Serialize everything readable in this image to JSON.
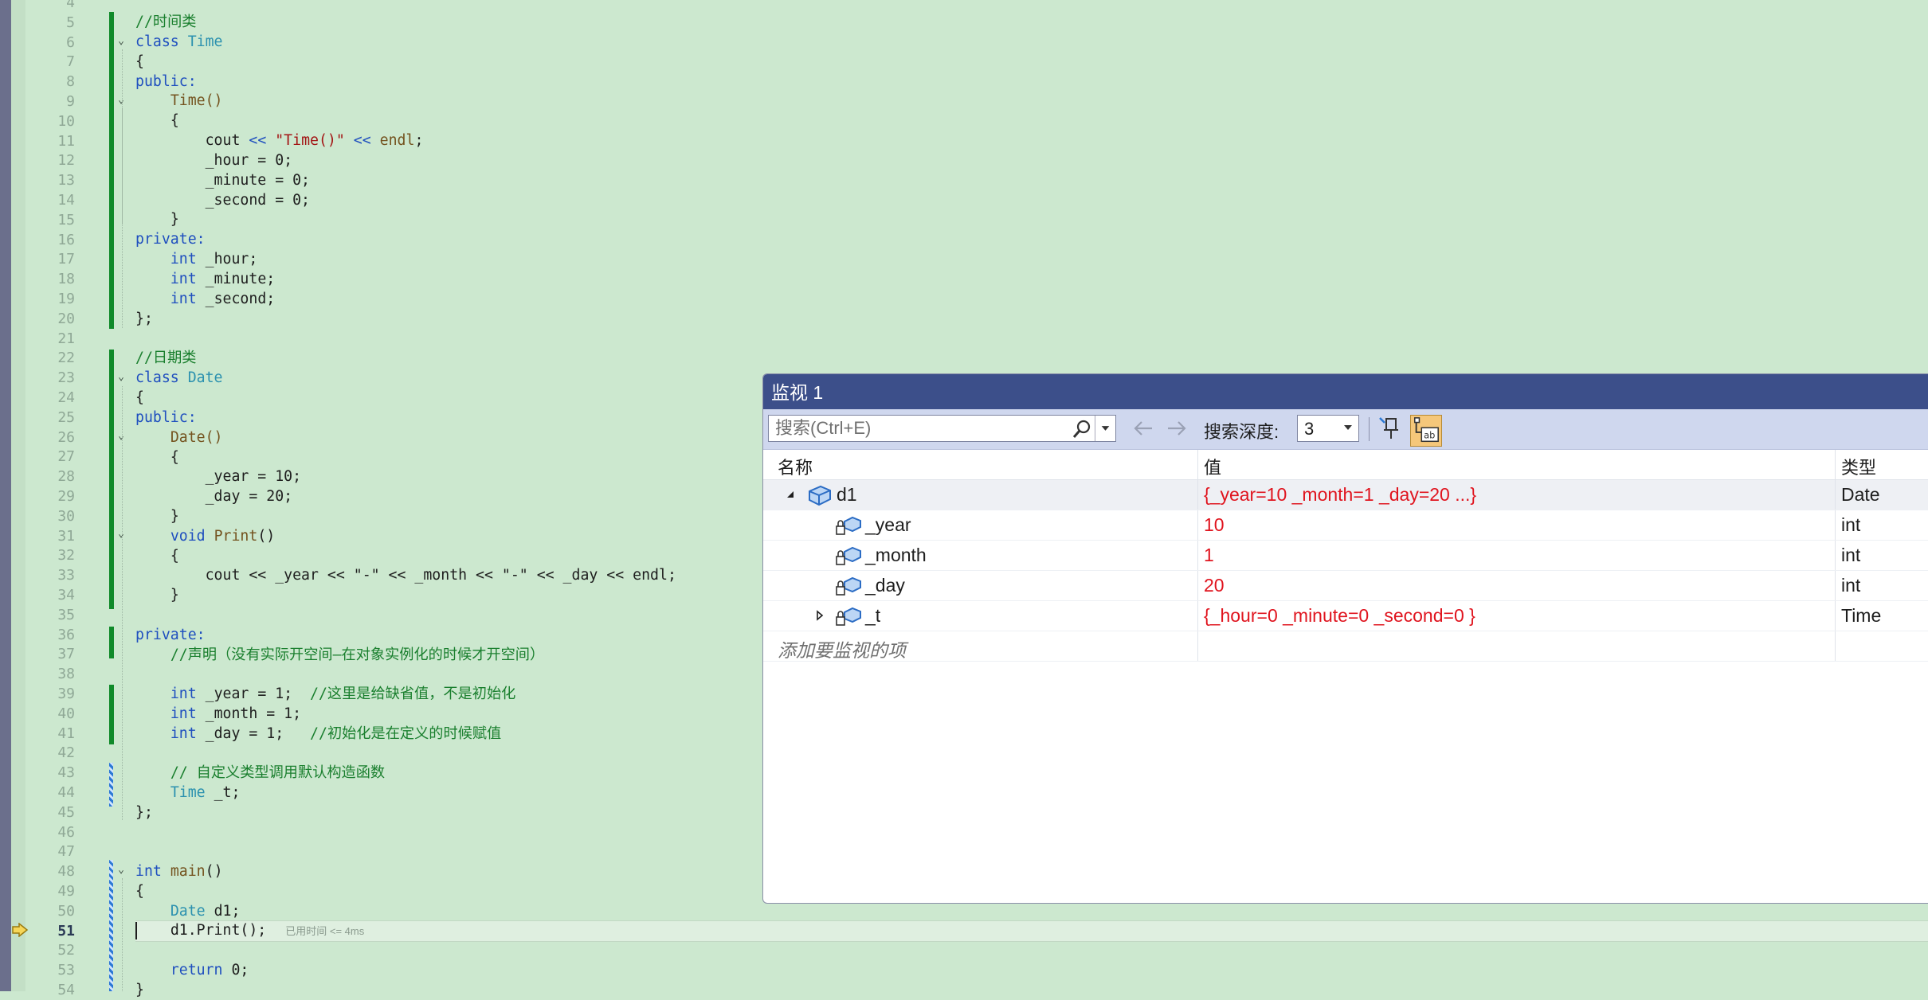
{
  "editor": {
    "current_line": "51",
    "elapsed_hint": "已用时间 <= 4ms",
    "line_numbers": [
      "4",
      "5",
      "6",
      "7",
      "8",
      "9",
      "10",
      "11",
      "12",
      "13",
      "14",
      "15",
      "16",
      "17",
      "18",
      "19",
      "20",
      "21",
      "22",
      "23",
      "24",
      "25",
      "26",
      "27",
      "28",
      "29",
      "30",
      "31",
      "32",
      "33",
      "34",
      "35",
      "36",
      "37",
      "38",
      "39",
      "40",
      "41",
      "42",
      "43",
      "44",
      "45",
      "46",
      "47",
      "48",
      "49",
      "50",
      "51",
      "52",
      "53",
      "54"
    ],
    "code": {
      "l5": "//时间类",
      "l6_kw": "class",
      "l6_name": "Time",
      "l7": "{",
      "l8": "public:",
      "l9": "Time()",
      "l10": "{",
      "l11_a": "cout",
      "l11_op1": "<<",
      "l11_str": "\"Time()\"",
      "l11_op2": "<<",
      "l11_endl": "endl",
      "l11_end": ";",
      "l12": "_hour = 0;",
      "l13": "_minute = 0;",
      "l14": "_second = 0;",
      "l15": "}",
      "l16": "private:",
      "l17_kw": "int",
      "l17_rest": "_hour;",
      "l18_kw": "int",
      "l18_rest": "_minute;",
      "l19_kw": "int",
      "l19_rest": "_second;",
      "l20": "};",
      "l22": "//日期类",
      "l23_kw": "class",
      "l23_name": "Date",
      "l24": "{",
      "l25": "public:",
      "l26": "Date()",
      "l27": "{",
      "l28": "_year = 10;",
      "l29": "_day = 20;",
      "l30": "}",
      "l31_kw": "void",
      "l31_fn": "Print",
      "l31_paren": "()",
      "l32": "{",
      "l33": "cout << _year << \"-\" << _month << \"-\" << _day << endl;",
      "l34": "}",
      "l36": "private:",
      "l37": "//声明（没有实际开空间—在对象实例化的时候才开空间）",
      "l39_kw": "int",
      "l39_rest": "_year = 1;",
      "l39_cm": "//这里是给缺省值，不是初始化",
      "l40_kw": "int",
      "l40_rest": "_month = 1;",
      "l41_kw": "int",
      "l41_rest": "_day = 1;",
      "l41_cm": "//初始化是在定义的时候赋值",
      "l43": "// 自定义类型调用默认构造函数",
      "l44_ty": "Time",
      "l44_rest": "_t;",
      "l45": "};",
      "l48_kw": "int",
      "l48_fn": "main",
      "l48_rest": "()",
      "l49": "{",
      "l50_ty": "Date",
      "l50_rest": "d1;",
      "l51": "d1.Print();",
      "l53_kw": "return",
      "l53_rest": "0;",
      "l54": "}"
    }
  },
  "watch": {
    "title": "监视 1",
    "search_placeholder": "搜索(Ctrl+E)",
    "depth_label": "搜索深度:",
    "depth_value": "3",
    "columns": {
      "name": "名称",
      "value": "值",
      "type": "类型"
    },
    "rows": [
      {
        "name": "d1",
        "value": "{_year=10 _month=1 _day=20 ...}",
        "type": "Date"
      },
      {
        "name": "_year",
        "value": "10",
        "type": "int"
      },
      {
        "name": "_month",
        "value": "1",
        "type": "int"
      },
      {
        "name": "_day",
        "value": "20",
        "type": "int"
      },
      {
        "name": "_t",
        "value": "{_hour=0 _minute=0 _second=0 }",
        "type": "Time"
      }
    ],
    "add_watch_placeholder": "添加要监视的项"
  },
  "colors": {
    "editor_bg": "#cce8cf",
    "watch_title_bg": "#3c4f8a",
    "value_changed": "#e0141e",
    "change_bar": "#108a2a"
  },
  "icons": [
    "search-icon",
    "back-arrow-icon",
    "forward-arrow-icon",
    "pin-icon",
    "ab-format-icon",
    "struct-icon",
    "lock-field-icon",
    "expand-icon",
    "collapse-icon",
    "current-statement-icon"
  ]
}
